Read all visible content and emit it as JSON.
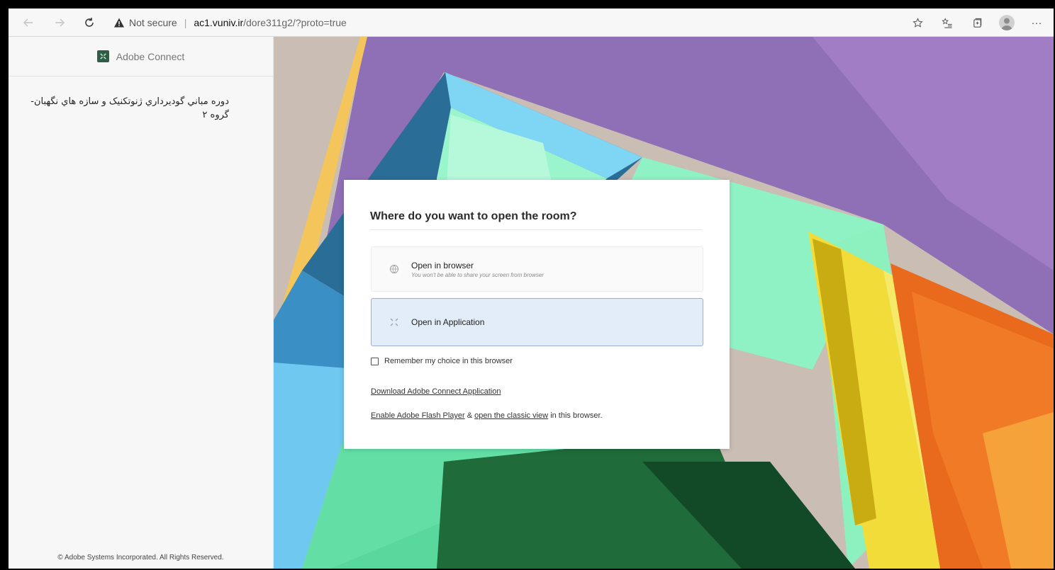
{
  "browser": {
    "security_label": "Not secure",
    "url_host": "ac1.vuniv.ir",
    "url_path": "/dore311g2/?proto=true",
    "separator": "|",
    "menu_label": "···"
  },
  "sidebar": {
    "brand": "Adobe Connect",
    "room_title": "دوره مباني گوديرداري ژنوتكنيک و سازه هاي نگهبان-گروه ۲",
    "footer": "© Adobe Systems Incorporated. All Rights Reserved."
  },
  "dialog": {
    "title": "Where do you want to open the room?",
    "option_browser_label": "Open in browser",
    "option_browser_note": "You won't be able to share your screen from browser",
    "option_app_label": "Open in Application",
    "remember_label": "Remember my choice in this browser",
    "download_link": "Download Adobe Connect Application",
    "flash_link": "Enable Adobe Flash Player",
    "flash_amp": "&",
    "classic_link": "open the classic view",
    "classic_suffix": "in this browser."
  },
  "icons": {
    "back": "arrow-left-icon",
    "forward": "arrow-right-icon",
    "reload": "reload-icon",
    "warning": "warning-triangle-icon",
    "favorite": "star-icon",
    "favorites_bar": "favorites-list-icon",
    "collections": "collections-icon",
    "profile": "avatar-icon"
  },
  "colors": {
    "purple": "#8f6fb5",
    "mint": "#8ff2c4",
    "green_dark": "#1f6b3a",
    "orange": "#e96a1c",
    "yellow": "#f2dc3a",
    "selected_bg": "#e3ecf9"
  }
}
